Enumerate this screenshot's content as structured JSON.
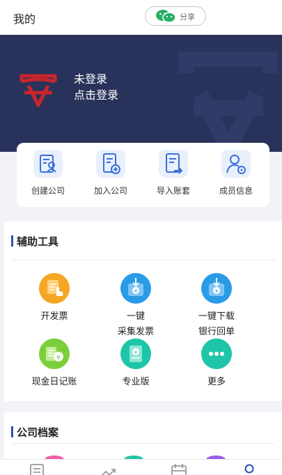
{
  "header": {
    "title": "我的",
    "share_label": "分享"
  },
  "banner": {
    "status": "未登录",
    "login": "点击登录"
  },
  "quick_actions": [
    {
      "label": "创建公司",
      "icon": "create-company-icon"
    },
    {
      "label": "加入公司",
      "icon": "join-company-icon"
    },
    {
      "label": "导入账套",
      "icon": "import-ledger-icon"
    },
    {
      "label": "成员信息",
      "icon": "member-info-icon"
    }
  ],
  "tools_section": {
    "title": "辅助工具",
    "items": [
      {
        "label": "开发票",
        "icon": "invoice-icon",
        "color": "#f5a623"
      },
      {
        "label": "一键\n采集发票",
        "icon": "collect-invoice-icon",
        "color": "#2a9be6"
      },
      {
        "label": "一键下载\n银行回单",
        "icon": "download-receipt-icon",
        "color": "#2a9be6"
      },
      {
        "label": "现金日记账",
        "icon": "cash-journal-icon",
        "color": "#7ccf3c"
      },
      {
        "label": "专业版",
        "icon": "pro-version-icon",
        "color": "#1ec5a8"
      },
      {
        "label": "更多",
        "icon": "more-icon",
        "color": "#1ec5a8"
      }
    ]
  },
  "archive_section": {
    "title": "公司档案"
  },
  "tabbar": [
    {
      "icon": "document-tab-icon"
    },
    {
      "icon": "trend-tab-icon"
    },
    {
      "icon": "calendar-tab-icon"
    },
    {
      "icon": "profile-tab-icon"
    }
  ],
  "colors": {
    "banner": "#29325a",
    "accent": "#2d4db7",
    "logo_red": "#c8252c"
  }
}
